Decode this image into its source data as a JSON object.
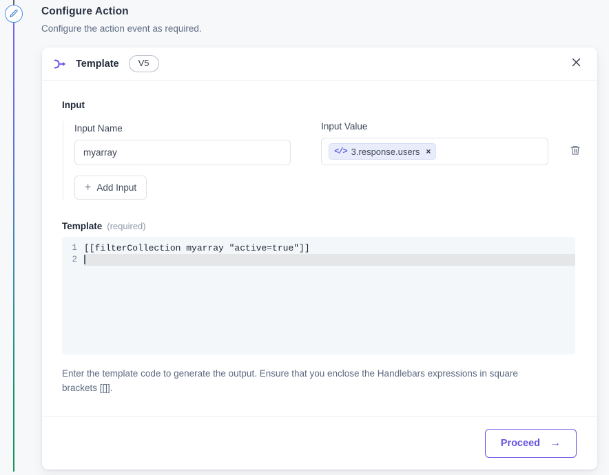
{
  "page": {
    "title": "Configure Action",
    "subtitle": "Configure the action event as required."
  },
  "rail": {
    "node_icon": "pencil-icon",
    "line_gradient_start": "#7b61e8",
    "line_gradient_end": "#0f9459"
  },
  "card": {
    "header": {
      "icon": "template-arrow-icon",
      "title": "Template",
      "version_badge": "V5",
      "close_icon": "close-icon"
    },
    "input_section": {
      "label": "Input",
      "name_label": "Input Name",
      "value_label": "Input Value",
      "name_value": "myarray",
      "name_placeholder": "Input Name",
      "token": {
        "icon": "code-icon",
        "icon_glyph": "</>",
        "text": "3.response.users",
        "remove_label": "×"
      },
      "delete_icon": "trash-icon",
      "add_input_label": "Add Input",
      "add_input_plus": "+"
    },
    "template_section": {
      "label": "Template",
      "required_label": "(required)",
      "code_lines": [
        {
          "number": "1",
          "text": "[[filterCollection myarray \"active=true\"]]",
          "active": false
        },
        {
          "number": "2",
          "text": "",
          "active": true
        }
      ],
      "helper_text": "Enter the template code to generate the output. Ensure that you enclose the Handlebars expressions in square brackets [[]]."
    },
    "footer": {
      "proceed_label": "Proceed",
      "proceed_arrow": "→",
      "accent_color": "#6b5ce7"
    }
  }
}
